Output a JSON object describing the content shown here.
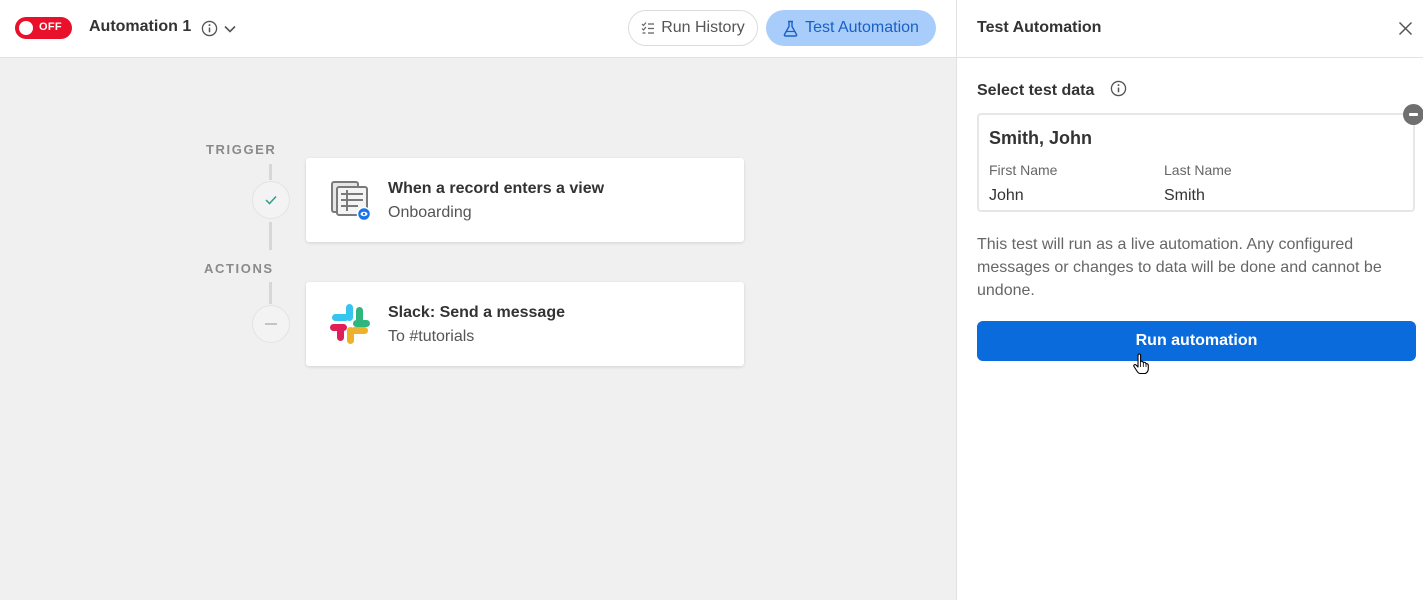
{
  "topbar": {
    "toggle_label": "OFF",
    "automation_title": "Automation 1",
    "run_history_label": "Run History",
    "test_automation_label": "Test Automation"
  },
  "workflow": {
    "trigger_label": "TRIGGER",
    "actions_label": "ACTIONS",
    "trigger_card": {
      "title": "When a record enters a view",
      "subtitle": "Onboarding",
      "icon": "table-view-icon"
    },
    "action_card": {
      "title": "Slack: Send a message",
      "subtitle": "To #tutorials",
      "icon": "slack-icon"
    }
  },
  "panel": {
    "title": "Test Automation",
    "select_label": "Select test data",
    "record": {
      "name": "Smith, John",
      "fields": [
        {
          "label": "First Name",
          "value": "John"
        },
        {
          "label": "Last Name",
          "value": "Smith"
        }
      ]
    },
    "description": "This test will run as a live automation. Any configured messages or changes to data will be done and cannot be undone.",
    "run_button_label": "Run automation"
  },
  "colors": {
    "toggle_off": "#e8102b",
    "test_button_bg": "#a9cdfa",
    "primary_blue": "#0a6bdc",
    "canvas_bg": "#f0f0f0"
  }
}
